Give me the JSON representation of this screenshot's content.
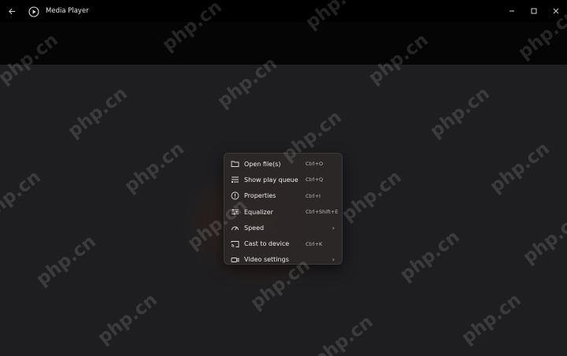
{
  "titlebar": {
    "back_icon": "back-arrow-icon",
    "app_icon": "media-player-icon",
    "title": "Media Player",
    "controls": [
      "minimize-icon",
      "maximize-icon",
      "close-icon"
    ]
  },
  "context_menu": {
    "items": [
      {
        "label": "Open file(s)",
        "shortcut": "Ctrl+O",
        "icon": "folder-icon",
        "submenu": false
      },
      {
        "label": "Show play queue",
        "shortcut": "Ctrl+Q",
        "icon": "queue-icon",
        "submenu": false
      },
      {
        "label": "Properties",
        "shortcut": "Ctrl+I",
        "icon": "info-icon",
        "submenu": false
      },
      {
        "label": "Equalizer",
        "shortcut": "Ctrl+Shift+E",
        "icon": "equalizer-icon",
        "submenu": false
      },
      {
        "label": "Speed",
        "shortcut": "",
        "icon": "speed-icon",
        "submenu": true
      },
      {
        "label": "Cast to device",
        "shortcut": "Ctrl+K",
        "icon": "cast-icon",
        "submenu": false
      },
      {
        "label": "Video settings",
        "shortcut": "",
        "icon": "video-settings-icon",
        "submenu": true
      }
    ]
  },
  "watermark": {
    "text": "php.cn"
  },
  "colors": {
    "background": "#1e1e20",
    "titlebar": "#000000",
    "menu": "#2c2826"
  }
}
